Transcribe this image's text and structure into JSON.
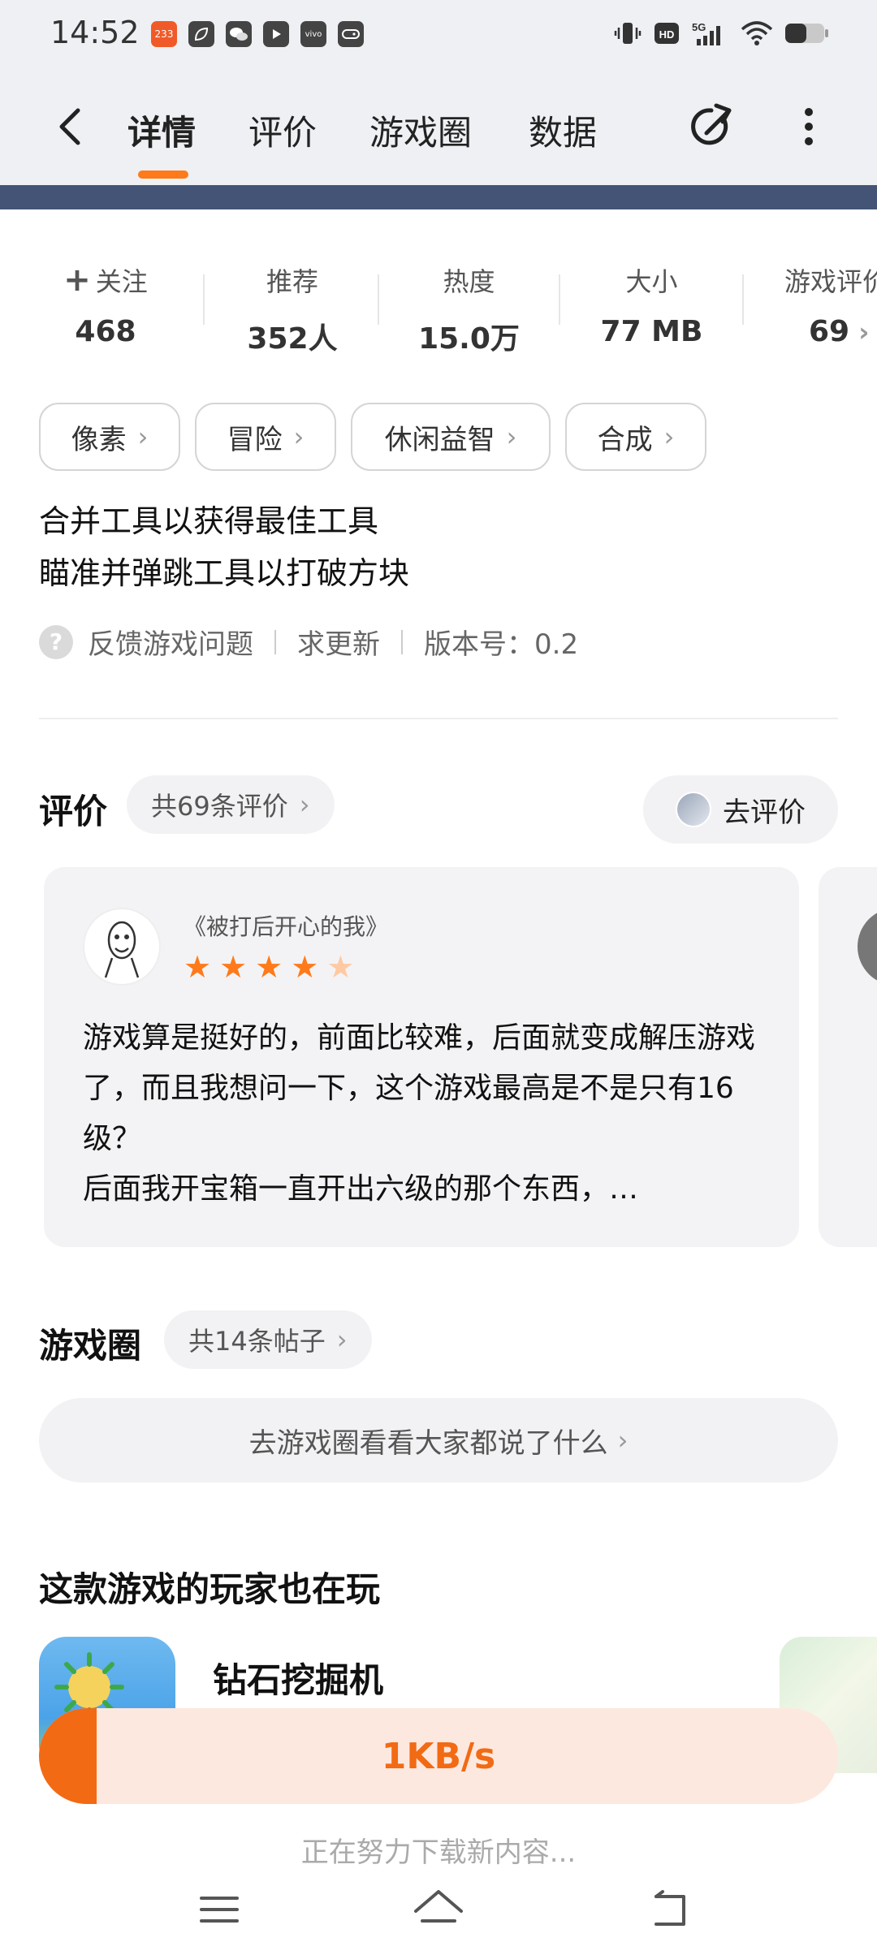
{
  "status_bar": {
    "time": "14:52",
    "app_icons": [
      "233",
      "leaf",
      "wechat",
      "play",
      "vivo",
      "game"
    ],
    "indicators": [
      "vibrate-icon",
      "hd-icon",
      "5g-signal-icon",
      "wifi-icon",
      "battery-icon"
    ]
  },
  "nav": {
    "tabs": [
      "详情",
      "评价",
      "游戏圈",
      "数据"
    ],
    "active_tab": 0,
    "accent": "#ff7a1a"
  },
  "stats": [
    {
      "label": "关注",
      "value": "468",
      "plus": "+"
    },
    {
      "label": "推荐",
      "value": "352人"
    },
    {
      "label": "热度",
      "value": "15.0万"
    },
    {
      "label": "大小",
      "value": "77 MB"
    },
    {
      "label": "游戏评价",
      "value": "69"
    }
  ],
  "tags": [
    "像素",
    "冒险",
    "休闲益智",
    "合成"
  ],
  "description": [
    "合并工具以获得最佳工具",
    "瞄准并弹跳工具以打破方块"
  ],
  "meta": {
    "feedback": "反馈游戏问题",
    "request_update": "求更新",
    "version": "版本号：0.2"
  },
  "reviews": {
    "title": "评价",
    "count": "共69条评价",
    "go_rate": "去评价",
    "items": [
      {
        "user": "《被打后开心的我》",
        "rating": 4.5,
        "text": "游戏算是挺好的，前面比较难，后面就变成解压游戏了，而且我想问一下，这个游戏最高是不是只有16级？\n后面我开宝箱一直开出六级的那个东西，…"
      }
    ]
  },
  "circle": {
    "title": "游戏圈",
    "count": "共14条帖子",
    "cta": "去游戏圈看看大家都说了什么"
  },
  "also_play": {
    "title": "这款游戏的玩家也在玩",
    "games": [
      {
        "name": "钻石挖掘机"
      }
    ]
  },
  "download": {
    "speed": "1KB/s",
    "progress": 0.072,
    "note": "正在努力下载新内容..."
  }
}
